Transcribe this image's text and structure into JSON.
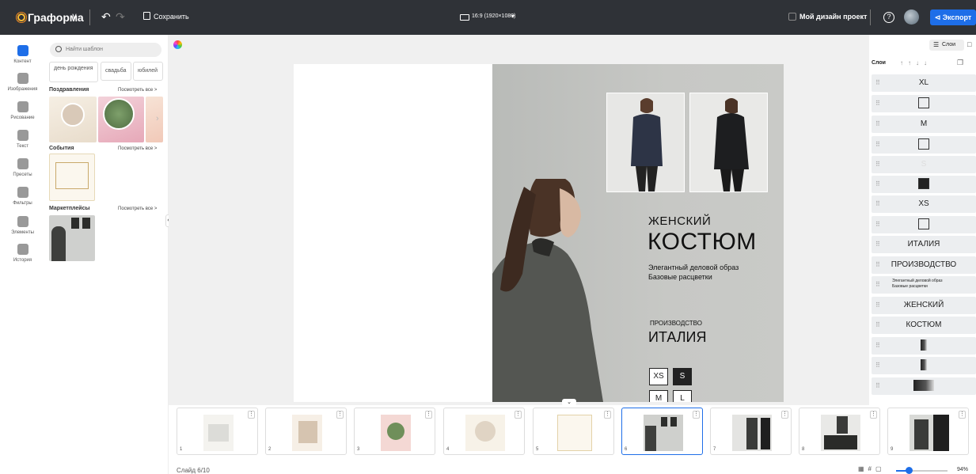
{
  "header": {
    "app_name": "Граформа",
    "save_label": "Сохранить",
    "format_label": "16:9 (1920×1080)",
    "project_label": "Мой дизайн проект",
    "help": "?",
    "export_label": "Экспорт"
  },
  "leftnav": [
    {
      "label": "Контент",
      "icon": "content-icon"
    },
    {
      "label": "Изображения",
      "icon": "image-icon"
    },
    {
      "label": "Рисование",
      "icon": "draw-icon"
    },
    {
      "label": "Текст",
      "icon": "text-icon"
    },
    {
      "label": "Пресеты",
      "icon": "preset-icon"
    },
    {
      "label": "Фильтры",
      "icon": "filter-icon"
    },
    {
      "label": "Элементы",
      "icon": "elements-icon"
    },
    {
      "label": "История",
      "icon": "history-icon"
    }
  ],
  "panel": {
    "search_placeholder": "Найти шаблон",
    "tags": [
      "день рождения",
      "свадьба",
      "юбилей"
    ],
    "sections": [
      {
        "title": "Поздравления",
        "see_all": "Посмотреть все >"
      },
      {
        "title": "События",
        "see_all": "Посмотреть все >"
      },
      {
        "title": "Маркетплейсы",
        "see_all": "Посмотреть все >"
      }
    ]
  },
  "slide": {
    "line1": "ЖЕНСКИЙ",
    "line2": "КОСТЮМ",
    "desc1": "Элегантный деловой образ",
    "desc2": "Базовые расцветки",
    "prod_label": "ПРОИЗВОДСТВО",
    "prod_value": "ИТАЛИЯ",
    "sizes": [
      "XS",
      "S",
      "M",
      "L"
    ]
  },
  "layers": {
    "button": "Слои",
    "title": "Слои",
    "items": [
      "XL",
      "",
      "M",
      "",
      "S",
      "",
      "XS",
      "",
      "ИТАЛИЯ",
      "ПРОИЗВОДСТВО",
      "Элегантный деловой образ Базовые расцветки",
      "ЖЕНСКИЙ",
      "КОСТЮМ",
      "",
      "",
      ""
    ]
  },
  "filmstrip": {
    "numbers": [
      "1",
      "2",
      "3",
      "4",
      "5",
      "6",
      "7",
      "8",
      "9"
    ],
    "selected": "6"
  },
  "footer": {
    "slide_counter": "Слайд 6/10",
    "zoom": "94%"
  },
  "colors": {
    "accent": "#1e6ee8",
    "topbar": "#2f3237"
  }
}
